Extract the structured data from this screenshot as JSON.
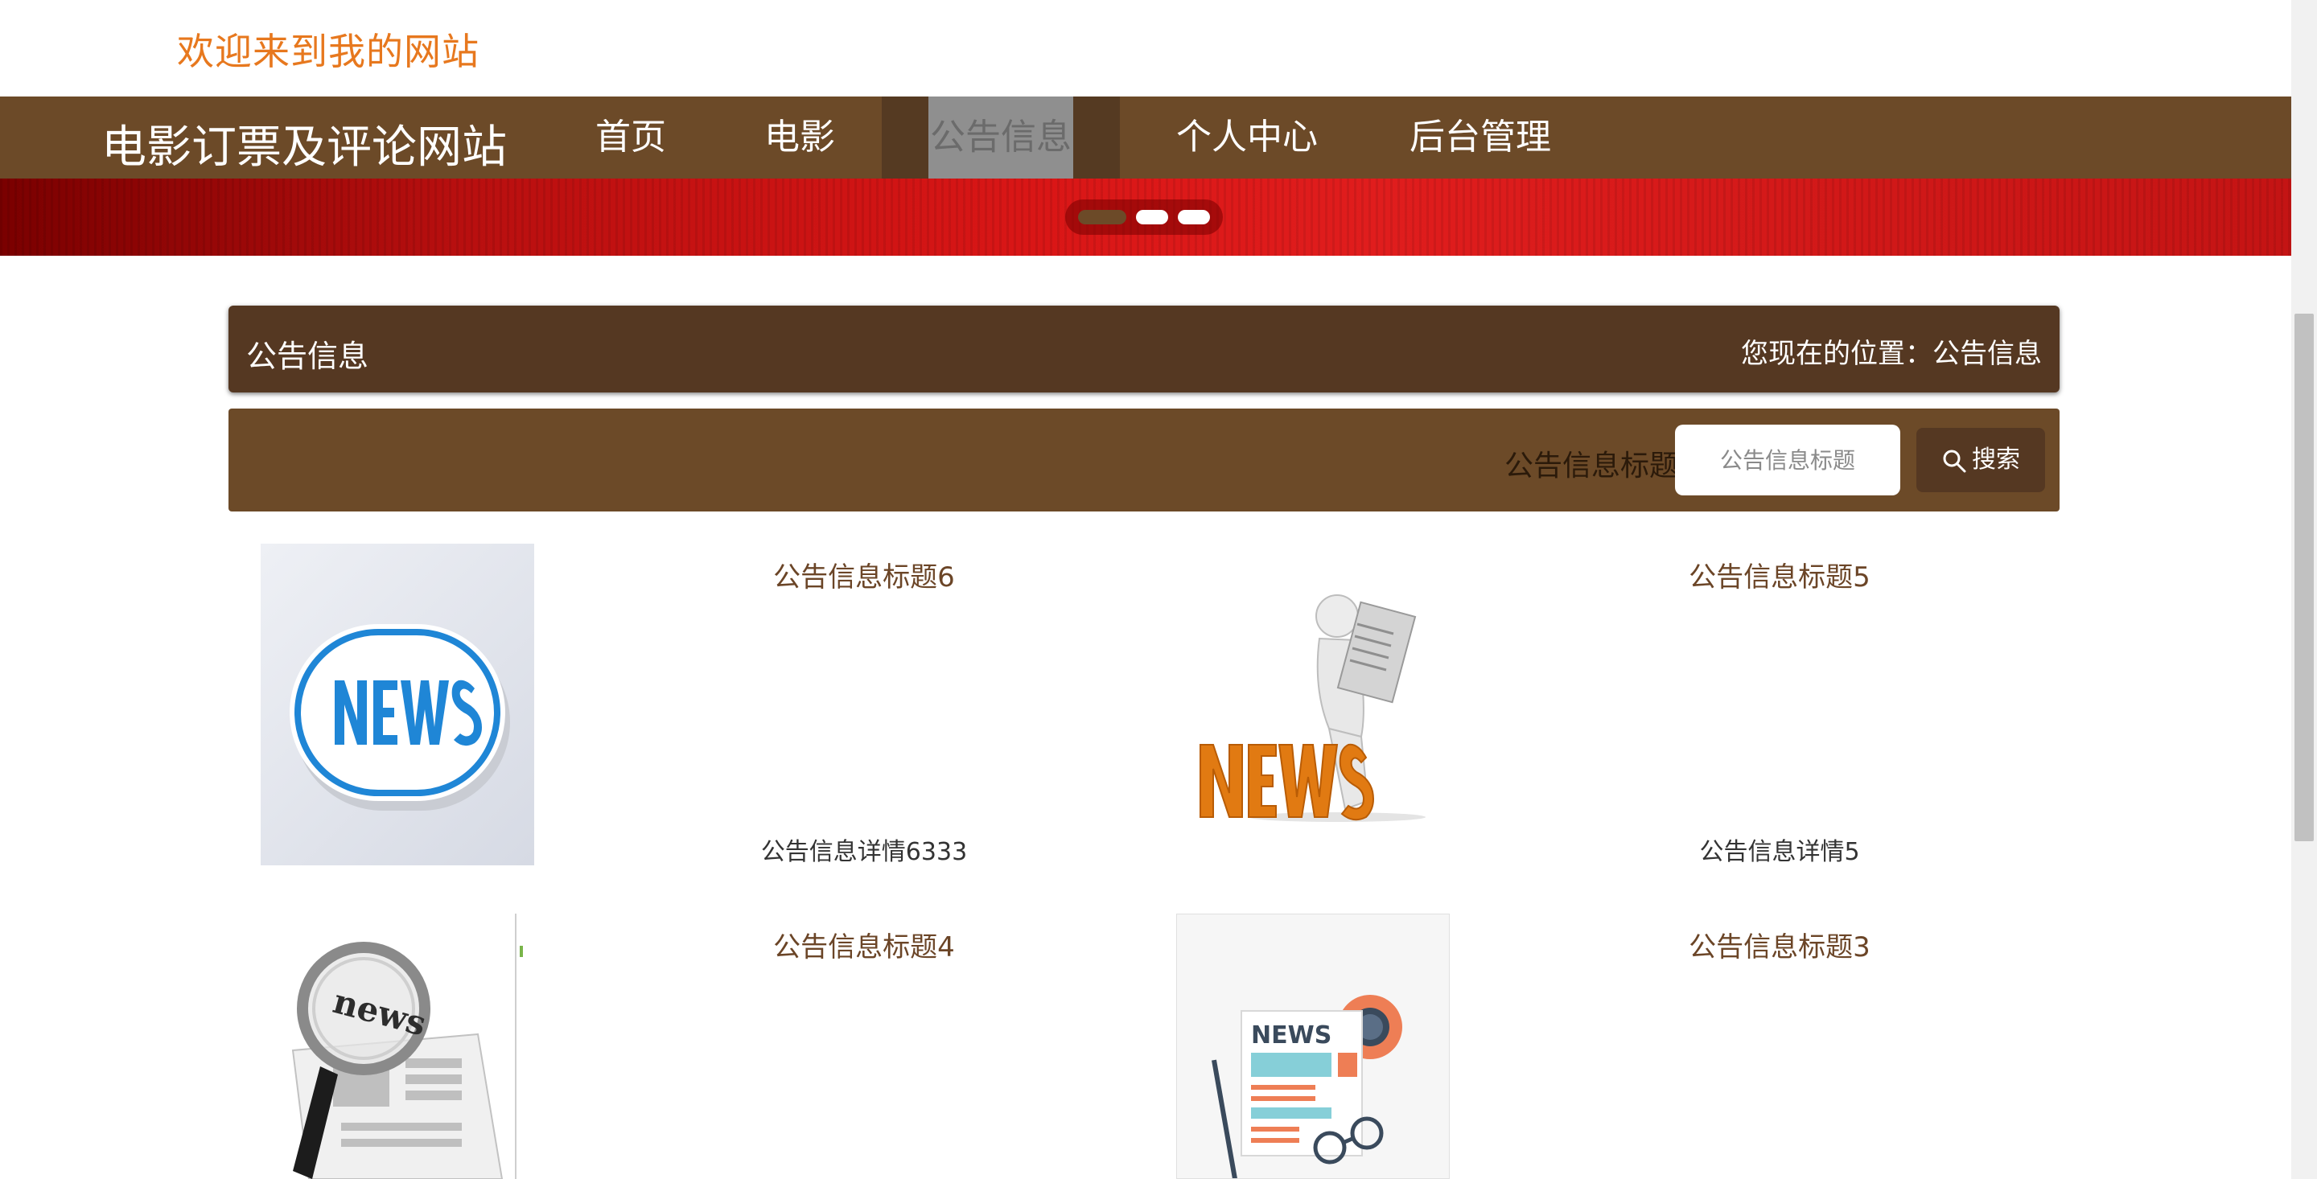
{
  "header": {
    "welcome": "欢迎来到我的网站"
  },
  "nav": {
    "site_title": "电影订票及评论网站",
    "items": [
      {
        "label": "首页"
      },
      {
        "label": "电影"
      },
      {
        "label": "公告信息"
      },
      {
        "label": "个人中心"
      },
      {
        "label": "后台管理"
      }
    ],
    "active_item": "公告信息"
  },
  "banner": {
    "carousel_dots": 3,
    "active_dot": 1
  },
  "breadcrumb": {
    "title": "公告信息",
    "location": "您现在的位置：公告信息"
  },
  "search": {
    "label": "公告信息标题",
    "placeholder": "公告信息标题",
    "button": "搜索"
  },
  "notices": [
    {
      "title": "公告信息标题6",
      "detail": "公告信息详情6333",
      "image": "news-button-image"
    },
    {
      "title": "公告信息标题5",
      "detail": "公告信息详情5",
      "image": "news-figure-reading-image"
    },
    {
      "title": "公告信息标题4",
      "detail": "",
      "image": "news-magnifier-image"
    },
    {
      "title": "公告信息标题3",
      "detail": "",
      "image": "news-flat-illustration-image"
    }
  ],
  "colors": {
    "brand_brown": "#6c4a28",
    "dark_brown": "#553822",
    "welcome_orange": "#e7781e",
    "banner_red": "#d91616"
  }
}
